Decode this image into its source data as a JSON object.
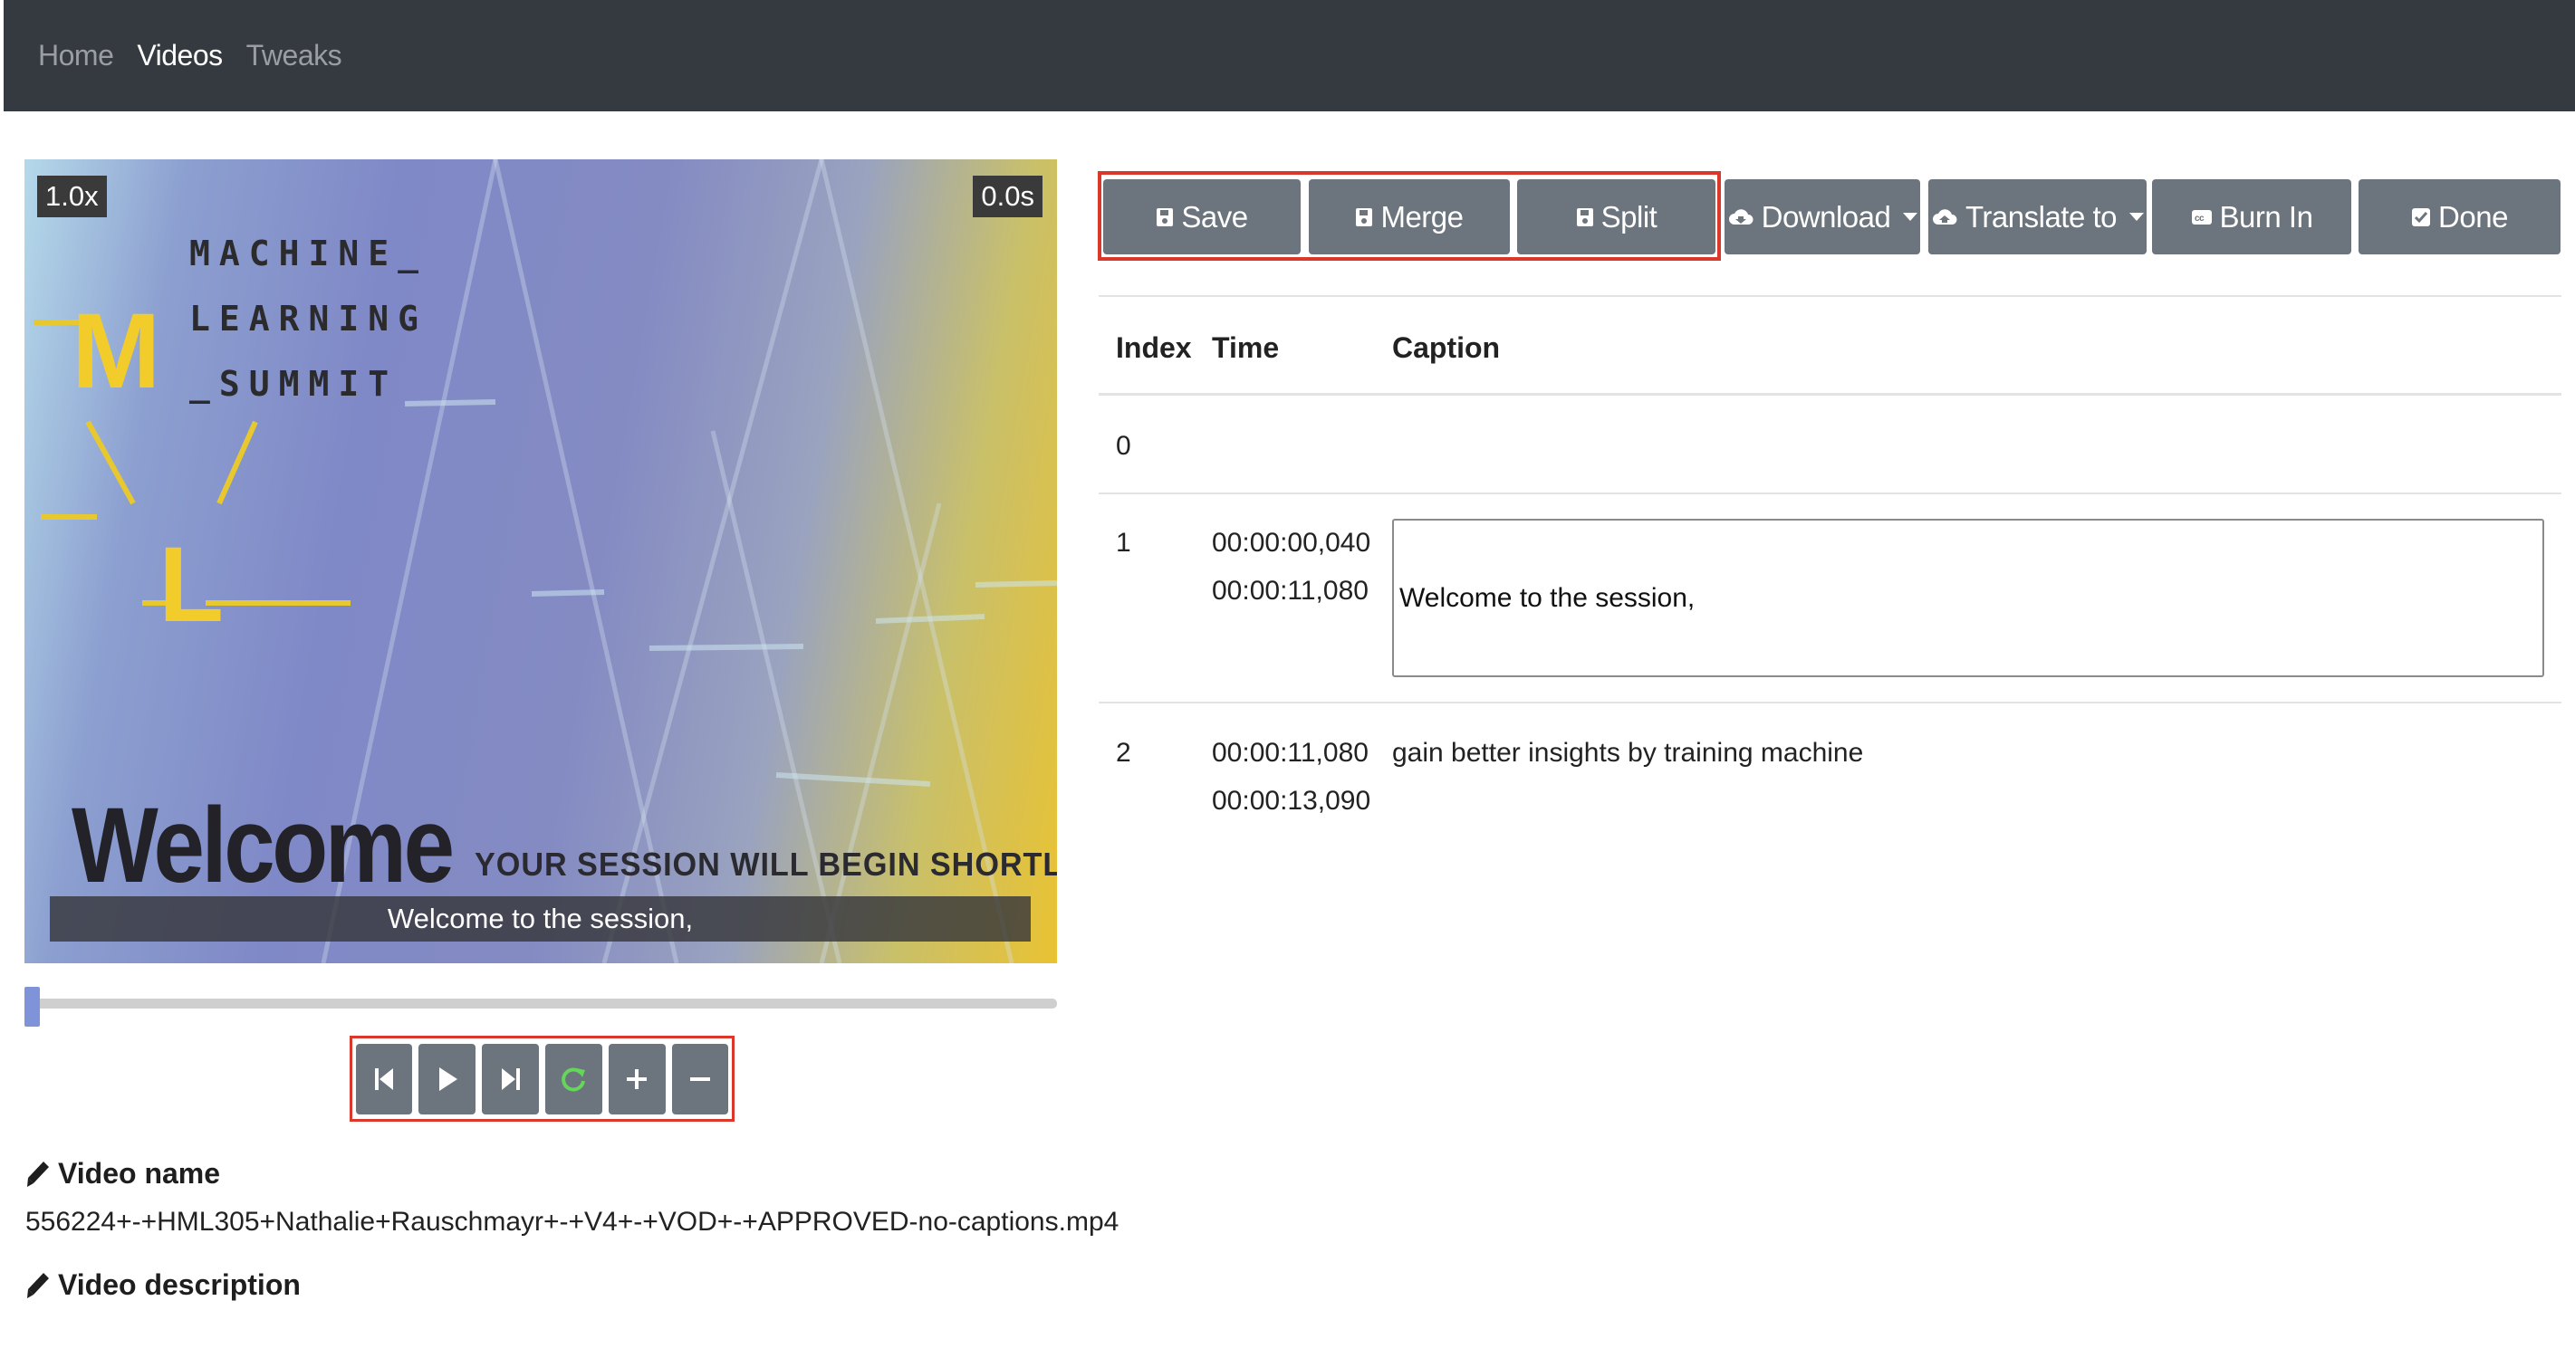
{
  "nav": {
    "home": "Home",
    "videos": "Videos",
    "tweaks": "Tweaks"
  },
  "video": {
    "speed": "1.0x",
    "time": "0.0s",
    "slide_title_lines": [
      "MACHINE_",
      "LEARNING",
      "_SUMMIT"
    ],
    "slide_logo_letters": [
      "M",
      "L"
    ],
    "slide_welcome": "Welcome",
    "slide_tagline": "YOUR SESSION WILL BEGIN SHORTLY",
    "subtitle": "Welcome to the session,",
    "progress": 0
  },
  "controls": {
    "icons": [
      "skip-back-icon",
      "play-icon",
      "skip-forward-icon",
      "replay-icon",
      "plus-icon",
      "minus-icon"
    ]
  },
  "meta": {
    "name_label": "Video name",
    "name_value": "556224+-+HML305+Nathalie+Rauschmayr+-+V4+-+VOD+-+APPROVED-no-captions.mp4",
    "description_label": "Video description"
  },
  "toolbar": {
    "save": "Save",
    "merge": "Merge",
    "split": "Split",
    "download": "Download",
    "translate": "Translate to",
    "burn_in": "Burn In",
    "done": "Done"
  },
  "table": {
    "headers": {
      "index": "Index",
      "time": "Time",
      "caption": "Caption"
    },
    "rows": [
      {
        "index": "0",
        "start": "",
        "end": "",
        "caption": ""
      },
      {
        "index": "1",
        "start": "00:00:00,040",
        "end": "00:00:11,080",
        "caption": "Welcome to the session,"
      },
      {
        "index": "2",
        "start": "00:00:11,080",
        "end": "00:00:13,090",
        "caption": "gain better insights by training machine"
      }
    ]
  },
  "colors": {
    "navbar": "#343a40",
    "button": "#6c757d",
    "highlight_border": "#d9382b",
    "seek_thumb": "#7f94d8",
    "replay_icon": "#64d65a"
  }
}
